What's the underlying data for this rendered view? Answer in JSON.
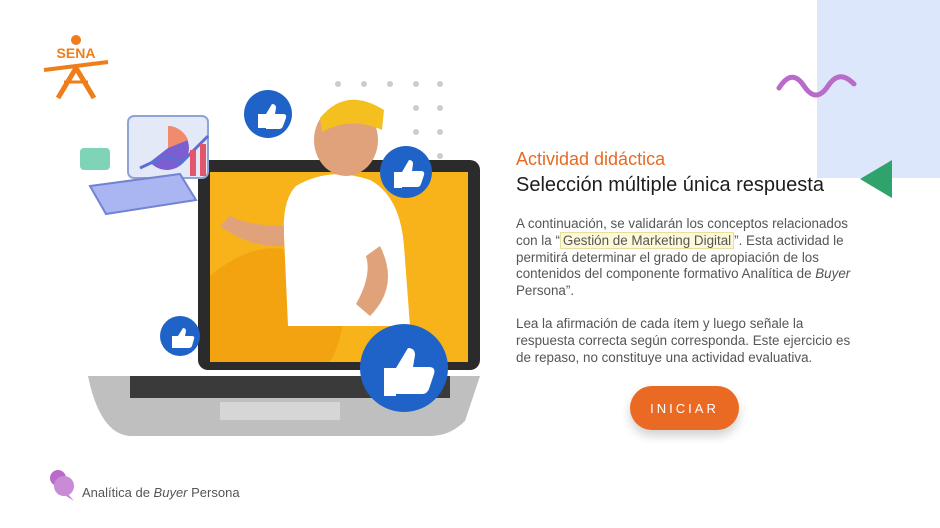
{
  "brand": {
    "logo_text": "SENA",
    "color": "#ef7d1a"
  },
  "activity": {
    "kicker": "Actividad didáctica",
    "title": "Selección múltiple única respuesta",
    "description": {
      "p1_before": "A continuación, se validarán los conceptos relacionados con la “",
      "p1_highlight": "Gestión de Marketing Digital",
      "p1_middle": "”. Esta actividad le permitirá determinar el grado de apropiación de los contenidos del componente formativo Analítica de ",
      "p1_italic": "Buyer",
      "p1_after": " Persona”.",
      "p2": "Lea la afirmación de cada ítem y luego señale la respuesta correcta según corresponda.  Este ejercicio es de repaso, no constituye una actividad evaluativa."
    },
    "start_button_label": "INICIAR"
  },
  "footer": {
    "label_before": "Analítica de ",
    "label_italic": "Buyer",
    "label_after": " Persona"
  },
  "colors": {
    "accent": "#ea6a24",
    "deco_blue": "#dde7fb",
    "deco_green": "#2fa36b",
    "deco_purple": "#b86bc9",
    "like_blue": "#1f63c8"
  },
  "icons": [
    "like-icon",
    "chart-icon",
    "calculator-icon",
    "laptop-icon",
    "chat-bubble-icon"
  ]
}
